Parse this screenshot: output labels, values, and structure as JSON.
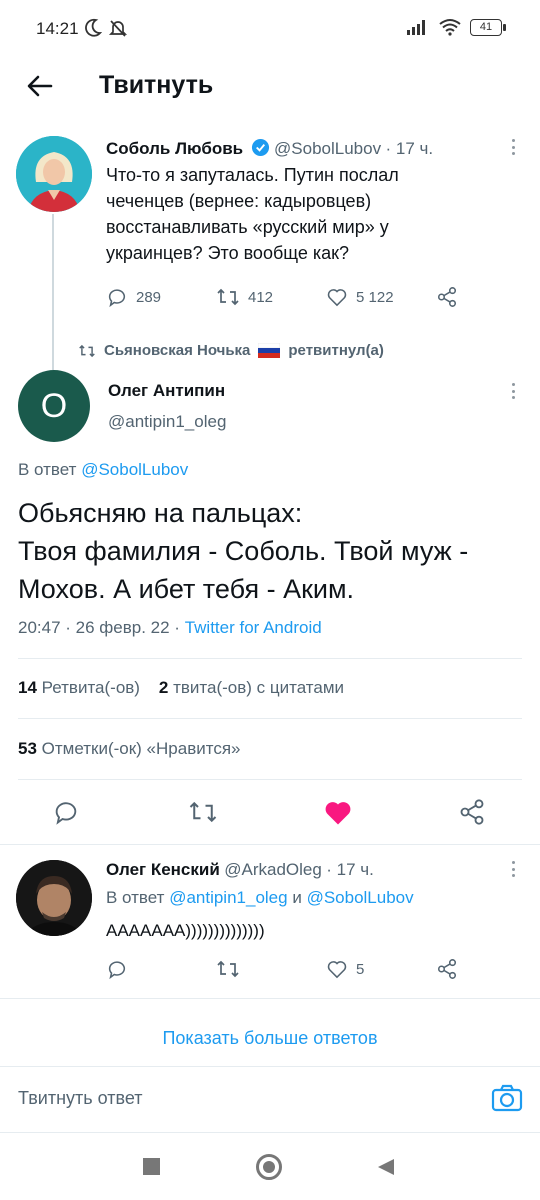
{
  "status_bar": {
    "time": "14:21",
    "battery": "41"
  },
  "header": {
    "title": "Твитнуть"
  },
  "parent_tweet": {
    "name": "Соболь Любовь",
    "handle": "@SobolLubov",
    "time": "· 17 ч.",
    "text": [
      "Что-то я запуталась. Путин послал",
      "чеченцев (вернее: кадыровцев)",
      "восстанавливать «русский мир» у",
      "украинцев? Это вообще как?"
    ],
    "replies": "289",
    "retweets": "412",
    "likes": "5 122"
  },
  "retweeted_by": {
    "text_before": "Сьяновская Ночька",
    "text_after": "ретвитнул(а)"
  },
  "main_tweet": {
    "avatar_letter": "О",
    "name": "Олег Антипин",
    "handle": "@antipin1_oleg",
    "reply_to_prefix": "В ответ",
    "reply_to_handle": "@SobolLubov",
    "text": [
      "Обьясняю на пальцах:",
      "Твоя фамилия - Соболь. Твой муж -",
      "Мохов. А ибет тебя - Аким."
    ],
    "datetime": "20:47 · 26 февр. 22 ·",
    "source": "Twitter for Android",
    "retweets_count": "14",
    "retweets_label": "Ретвита(-ов)",
    "quotes_count": "2",
    "quotes_label": "твита(-ов) с цитатами",
    "likes_count": "53",
    "likes_label": "Отметки(-ок) «Нравится»"
  },
  "reply_tweet": {
    "name": "Олег Кенский",
    "handle": "@ArkadOleg",
    "time": "· 17 ч.",
    "reply_prefix": "В ответ",
    "reply_handle1": "@antipin1_oleg",
    "reply_and": "и",
    "reply_handle2": "@SobolLubov",
    "text": "АААААAA))))))))))))))",
    "likes": "5"
  },
  "show_more": "Показать больше ответов",
  "reply_bar": {
    "placeholder": "Твитнуть ответ"
  },
  "colors": {
    "accent": "#1d9bf0",
    "like": "#f91880",
    "avatar_green": "#1a5a4c"
  }
}
